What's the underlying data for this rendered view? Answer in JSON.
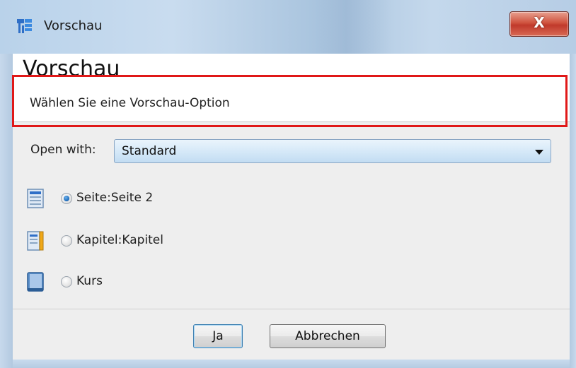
{
  "window": {
    "title": "Vorschau",
    "close_label": "X"
  },
  "header": {
    "title": "Vorschau",
    "subtitle": "Wählen Sie eine Vorschau-Option"
  },
  "open_with": {
    "label": "Open with:",
    "selected": "Standard"
  },
  "options": [
    {
      "label": "Seite:Seite 2",
      "checked": true,
      "icon": "page-icon"
    },
    {
      "label": "Kapitel:Kapitel",
      "checked": false,
      "icon": "chapter-icon"
    },
    {
      "label": "Kurs",
      "checked": false,
      "icon": "course-book-icon"
    }
  ],
  "buttons": {
    "yes_label": "Ja",
    "cancel_label": "Abbrechen"
  },
  "colors": {
    "highlight_border": "#e01818",
    "close_button": "#c0392b"
  }
}
